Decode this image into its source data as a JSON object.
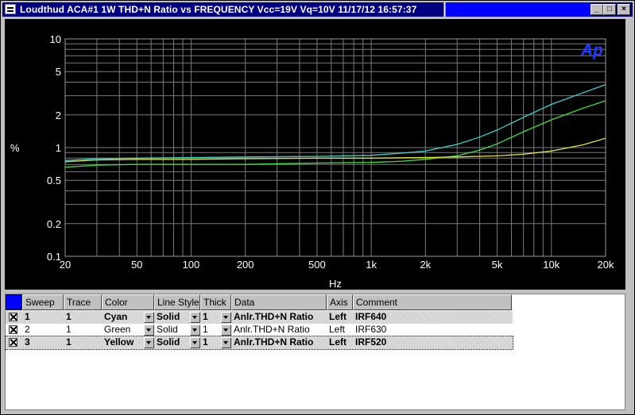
{
  "window": {
    "title": "Loudthud  ACA#1 1W THD+N Ratio vs FREQUENCY Vcc=19V  Vq=10V  11/17/12 16:57:37",
    "minimize_glyph": "_",
    "maximize_glyph": "□",
    "close_glyph": "×",
    "colors": {
      "titlebar": "#000080",
      "accent": "#0000ff"
    }
  },
  "chart_data": {
    "type": "line",
    "title": "",
    "xlabel": "Hz",
    "ylabel": "%",
    "x_scale": "log",
    "y_scale": "log",
    "xlim": [
      20,
      20000
    ],
    "ylim": [
      0.1,
      10
    ],
    "grid": true,
    "legend": "none",
    "x_tick_labels": [
      {
        "value": 20,
        "label": "20"
      },
      {
        "value": 50,
        "label": "50"
      },
      {
        "value": 100,
        "label": "100"
      },
      {
        "value": 200,
        "label": "200"
      },
      {
        "value": 500,
        "label": "500"
      },
      {
        "value": 1000,
        "label": "1k"
      },
      {
        "value": 2000,
        "label": "2k"
      },
      {
        "value": 5000,
        "label": "5k"
      },
      {
        "value": 10000,
        "label": "10k"
      },
      {
        "value": 20000,
        "label": "20k"
      }
    ],
    "y_tick_labels": [
      {
        "value": 10,
        "label": "10"
      },
      {
        "value": 5,
        "label": "5"
      },
      {
        "value": 2,
        "label": "2"
      },
      {
        "value": 1,
        "label": "1"
      },
      {
        "value": 0.5,
        "label": "0.5"
      },
      {
        "value": 0.2,
        "label": "0.2"
      },
      {
        "value": 0.1,
        "label": "0.1"
      }
    ],
    "logo": "Ap",
    "series": [
      {
        "color": "#3cd2d2",
        "x": [
          20,
          30,
          50,
          100,
          200,
          500,
          1000,
          1500,
          2000,
          3000,
          4000,
          5000,
          7000,
          10000,
          15000,
          20000
        ],
        "y": [
          0.76,
          0.79,
          0.8,
          0.81,
          0.82,
          0.83,
          0.85,
          0.89,
          0.93,
          1.07,
          1.25,
          1.45,
          1.9,
          2.5,
          3.2,
          3.8
        ]
      },
      {
        "color": "#40dc40",
        "x": [
          20,
          30,
          50,
          100,
          200,
          500,
          1000,
          1500,
          2000,
          3000,
          4000,
          5000,
          7000,
          10000,
          15000,
          20000
        ],
        "y": [
          0.66,
          0.69,
          0.7,
          0.7,
          0.7,
          0.72,
          0.73,
          0.75,
          0.78,
          0.84,
          0.95,
          1.08,
          1.4,
          1.8,
          2.3,
          2.7
        ]
      },
      {
        "color": "#e0e040",
        "x": [
          20,
          30,
          50,
          100,
          200,
          500,
          1000,
          2000,
          3000,
          5000,
          7000,
          10000,
          15000,
          20000
        ],
        "y": [
          0.74,
          0.77,
          0.78,
          0.78,
          0.79,
          0.8,
          0.8,
          0.81,
          0.82,
          0.84,
          0.87,
          0.93,
          1.06,
          1.22
        ]
      }
    ]
  },
  "table": {
    "corner_color": "#0000ff",
    "headers": [
      "Sweep",
      "Trace",
      "Color",
      "Line Style",
      "Thick",
      "Data",
      "Axis",
      "Comment"
    ],
    "rows": [
      {
        "sweep": "1",
        "trace": "1",
        "color": "Cyan",
        "line_style": "Solid",
        "thick": "1",
        "data": "Anlr.THD+N Ratio",
        "axis": "Left",
        "comment": "IRF640"
      },
      {
        "sweep": "2",
        "trace": "1",
        "color": "Green",
        "line_style": "Solid",
        "thick": "1",
        "data": "Anlr.THD+N Ratio",
        "axis": "Left",
        "comment": "IRF630"
      },
      {
        "sweep": "3",
        "trace": "1",
        "color": "Yellow",
        "line_style": "Solid",
        "thick": "1",
        "data": "Anlr.THD+N Ratio",
        "axis": "Left",
        "comment": "IRF520"
      }
    ]
  }
}
